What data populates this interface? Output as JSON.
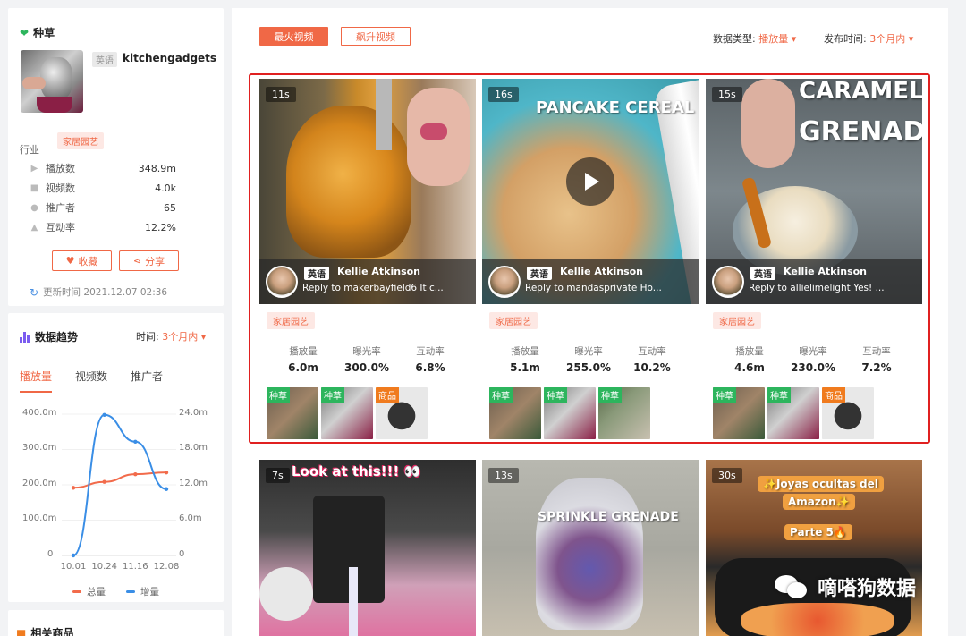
{
  "profile": {
    "section_title": "种草",
    "lang_tag": "英语",
    "username": "kitchengadgets",
    "industry_label": "行业",
    "industry_tag": "家居园艺",
    "stats": [
      {
        "icon": "play-count-icon",
        "label": "播放数",
        "value": "348.9m"
      },
      {
        "icon": "video-count-icon",
        "label": "视频数",
        "value": "4.0k"
      },
      {
        "icon": "promoter-icon",
        "label": "推广者",
        "value": "65"
      },
      {
        "icon": "thumb-up-icon",
        "label": "互动率",
        "value": "12.2%"
      }
    ],
    "collect_label": "收藏",
    "share_label": "分享",
    "update_time": "更新时间 2021.12.07 02:36"
  },
  "trend": {
    "title": "数据趋势",
    "time_label": "时间:",
    "time_value": "3个月内",
    "tabs": [
      "播放量",
      "视频数",
      "推广者"
    ],
    "active_tab": "播放量",
    "legend_total": "总量",
    "legend_increment": "增量",
    "colors": {
      "total": "#f26b4b",
      "increment": "#3a8ee6"
    }
  },
  "chart_data": {
    "type": "line",
    "categories": [
      "10.01",
      "10.24",
      "11.16",
      "12.08"
    ],
    "series": [
      {
        "name": "总量",
        "axis": "right",
        "values": [
          11.5,
          12.5,
          13.8,
          14.1
        ]
      },
      {
        "name": "增量",
        "axis": "left",
        "values": [
          0,
          398,
          322,
          188
        ]
      }
    ],
    "left_axis": {
      "ticks": [
        "0",
        "100.0m",
        "200.0m",
        "300.0m",
        "400.0m"
      ],
      "range": [
        0,
        400
      ]
    },
    "right_axis": {
      "ticks": [
        "0",
        "6.0m",
        "12.0m",
        "18.0m",
        "24.0m"
      ],
      "range": [
        0,
        24
      ]
    },
    "grid": true,
    "legend": "bottom"
  },
  "related": {
    "title": "相关商品"
  },
  "main": {
    "tabs": [
      {
        "label": "最火视频",
        "active": true
      },
      {
        "label": "飙升视频",
        "active": false
      }
    ],
    "filter_type_label": "数据类型:",
    "filter_type_value": "播放量",
    "filter_time_label": "发布时间:",
    "filter_time_value": "3个月内",
    "cards": [
      {
        "duration": "11s",
        "lang": "英语",
        "author": "Kellie Atkinson",
        "reply": "Reply to makerbayfield6 It c...",
        "category": "家居园艺",
        "metrics": [
          {
            "label": "播放量",
            "value": "6.0m"
          },
          {
            "label": "曝光率",
            "value": "300.0%"
          },
          {
            "label": "互动率",
            "value": "6.8%"
          }
        ],
        "products": [
          {
            "label": "种草",
            "kind": "green"
          },
          {
            "label": "种草",
            "kind": "green"
          },
          {
            "label": "商品",
            "kind": "orange"
          }
        ]
      },
      {
        "duration": "16s",
        "overlay_text": "PANCAKE CEREAL",
        "lang": "英语",
        "author": "Kellie Atkinson",
        "reply": "Reply to mandasprivate Ho...",
        "category": "家居园艺",
        "metrics": [
          {
            "label": "播放量",
            "value": "5.1m"
          },
          {
            "label": "曝光率",
            "value": "255.0%"
          },
          {
            "label": "互动率",
            "value": "10.2%"
          }
        ],
        "products": [
          {
            "label": "种草",
            "kind": "green"
          },
          {
            "label": "种草",
            "kind": "green"
          },
          {
            "label": "种草",
            "kind": "green"
          }
        ]
      },
      {
        "duration": "15s",
        "overlay_text_1": "CARAMEL",
        "overlay_text_2": "GRENADE",
        "lang": "英语",
        "author": "Kellie Atkinson",
        "reply": "Reply to allielimelight Yes! ...",
        "category": "家居园艺",
        "metrics": [
          {
            "label": "播放量",
            "value": "4.6m"
          },
          {
            "label": "曝光率",
            "value": "230.0%"
          },
          {
            "label": "互动率",
            "value": "7.2%"
          }
        ],
        "products": [
          {
            "label": "种草",
            "kind": "green"
          },
          {
            "label": "种草",
            "kind": "green"
          },
          {
            "label": "商品",
            "kind": "orange"
          }
        ]
      }
    ],
    "second_row": [
      {
        "duration": "7s",
        "overlay_text": "Look at this!!! 👀"
      },
      {
        "duration": "13s",
        "overlay_text": "SPRINKLE GRENADE"
      },
      {
        "duration": "30s",
        "overlay_text_1": "✨Joyas ocultas del",
        "overlay_text_2": "Amazon✨",
        "overlay_text_3": "Parte 5🔥"
      }
    ]
  },
  "watermark": {
    "text": "嘀嗒狗数据"
  }
}
